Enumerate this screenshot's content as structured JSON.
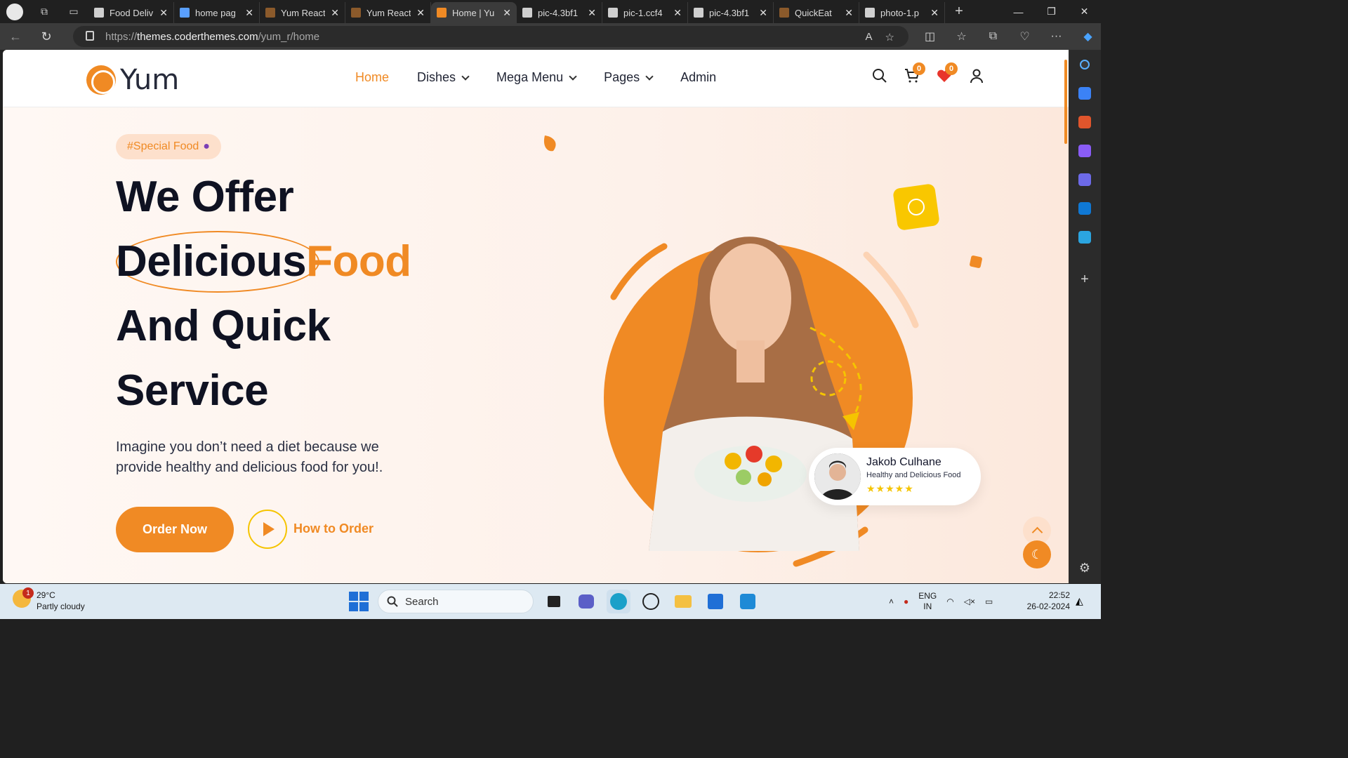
{
  "browser": {
    "tabs": [
      {
        "title": "Food Deliv",
        "active": false
      },
      {
        "title": "home pag",
        "active": false
      },
      {
        "title": "Yum React",
        "active": false
      },
      {
        "title": "Yum React",
        "active": false
      },
      {
        "title": "Home | Yu",
        "active": true
      },
      {
        "title": "pic-4.3bf1",
        "active": false
      },
      {
        "title": "pic-1.ccf4",
        "active": false
      },
      {
        "title": "pic-4.3bf1",
        "active": false
      },
      {
        "title": "QuickEat",
        "active": false
      },
      {
        "title": "photo-1.p",
        "active": false
      }
    ],
    "url_prefix": "https://",
    "url_host": "themes.coderthemes.com",
    "url_path": "/yum_r/home"
  },
  "site": {
    "brand": "Yum",
    "nav": [
      {
        "label": "Home",
        "active": true,
        "dropdown": false
      },
      {
        "label": "Dishes",
        "active": false,
        "dropdown": true
      },
      {
        "label": "Mega Menu",
        "active": false,
        "dropdown": true
      },
      {
        "label": "Pages",
        "active": false,
        "dropdown": true
      },
      {
        "label": "Admin",
        "active": false,
        "dropdown": false
      }
    ],
    "cart_count": "0",
    "wishlist_count": "0"
  },
  "hero": {
    "chip": "#Special Food",
    "line1": "We Offer",
    "line2a": "Delicious",
    "line2b": "Food",
    "line3": "And Quick",
    "line4": "Service",
    "description": "Imagine you don’t need a diet because we provide healthy and delicious food for you!.",
    "order_button": "Order Now",
    "how_link": "How to Order"
  },
  "review": {
    "name": "Jakob Culhane",
    "subtitle": "Healthy and Delicious Food",
    "stars": "★★★★★"
  },
  "taskbar": {
    "weather_temp": "29°C",
    "weather_desc": "Partly cloudy",
    "weather_badge": "1",
    "search": "Search",
    "lang1": "ENG",
    "lang2": "IN",
    "time": "22:52",
    "date": "26-02-2024"
  },
  "colors": {
    "accent": "#f08a24",
    "yellow": "#f9c700",
    "heading": "#0f1222"
  }
}
